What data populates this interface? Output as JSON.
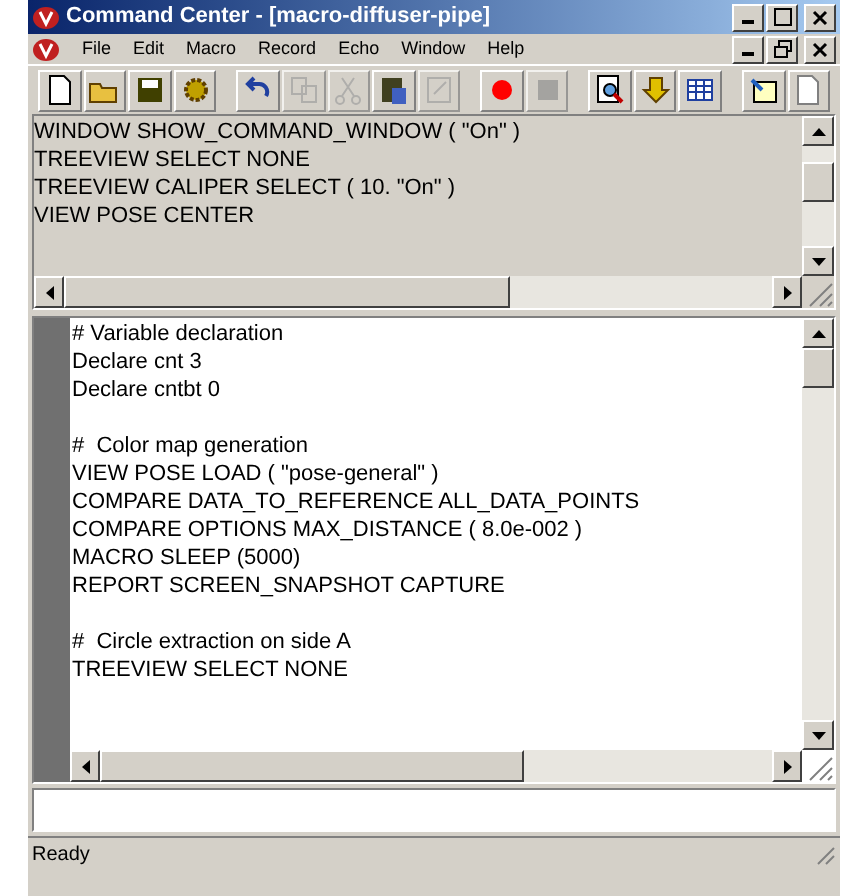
{
  "window": {
    "title": "Command Center - [macro-diffuser-pipe]"
  },
  "menu": [
    "File",
    "Edit",
    "Macro",
    "Record",
    "Echo",
    "Window",
    "Help"
  ],
  "toolbar": [
    {
      "kind": "new",
      "disabled": false
    },
    {
      "kind": "open",
      "disabled": false
    },
    {
      "kind": "save",
      "disabled": false
    },
    {
      "kind": "gear",
      "disabled": false
    },
    {
      "kind": "sep"
    },
    {
      "kind": "undo",
      "disabled": false
    },
    {
      "kind": "copy",
      "disabled": true
    },
    {
      "kind": "cut",
      "disabled": true
    },
    {
      "kind": "paste",
      "disabled": false
    },
    {
      "kind": "edit",
      "disabled": true
    },
    {
      "kind": "sep"
    },
    {
      "kind": "record",
      "disabled": false
    },
    {
      "kind": "stop",
      "disabled": true
    },
    {
      "kind": "sep"
    },
    {
      "kind": "find",
      "disabled": false
    },
    {
      "kind": "down",
      "disabled": false
    },
    {
      "kind": "grid",
      "disabled": false
    },
    {
      "kind": "sep"
    },
    {
      "kind": "doc",
      "disabled": false
    },
    {
      "kind": "page",
      "disabled": false
    }
  ],
  "output_lines": [
    "WINDOW SHOW_COMMAND_WINDOW ( \"On\" )",
    "TREEVIEW SELECT NONE",
    "TREEVIEW CALIPER SELECT ( 10. \"On\" )",
    "VIEW POSE CENTER"
  ],
  "editor_blocks": [
    [
      "# Variable declaration",
      "Declare cnt 3",
      "Declare cntbt 0"
    ],
    [
      "#  Color map generation",
      "VIEW POSE LOAD ( \"pose-general\" )",
      "COMPARE DATA_TO_REFERENCE ALL_DATA_POINTS",
      "COMPARE OPTIONS MAX_DISTANCE ( 8.0e-002 )",
      "MACRO SLEEP (5000)",
      "REPORT SCREEN_SNAPSHOT CAPTURE"
    ],
    [
      "#  Circle extraction on side A",
      "TREEVIEW SELECT NONE"
    ]
  ],
  "status_bar": "Ready"
}
